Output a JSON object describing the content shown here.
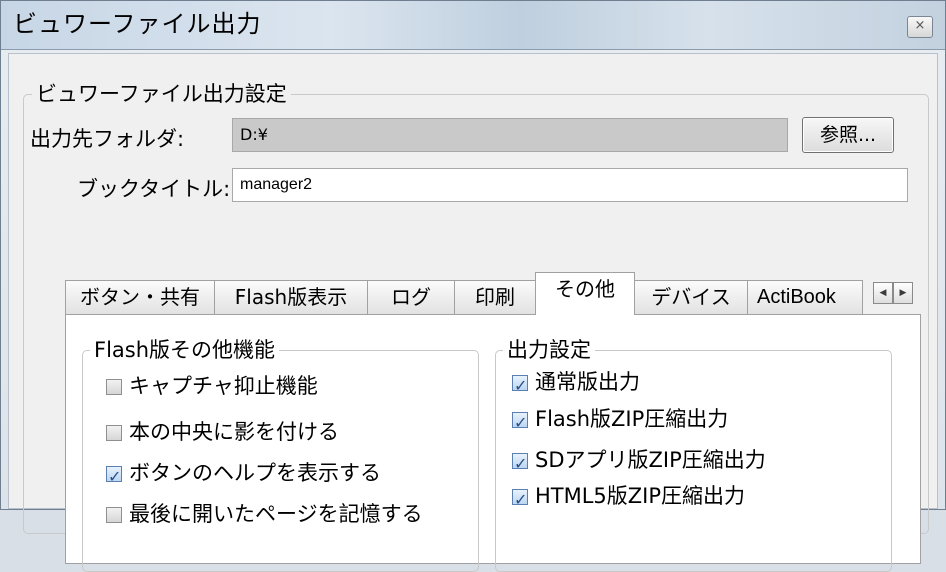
{
  "window": {
    "title": "ビュワーファイル出力",
    "close_icon": "close-icon"
  },
  "settings": {
    "group_title": "ビュワーファイル出力設定",
    "output_folder_label": "出力先フォルダ:",
    "output_folder_value": "D:¥",
    "browse_label": "参照...",
    "book_title_label": "ブックタイトル:",
    "book_title_value": "manager2"
  },
  "tabs": [
    {
      "label": "ボタン・共有"
    },
    {
      "label": "Flash版表示"
    },
    {
      "label": "ログ"
    },
    {
      "label": "印刷"
    },
    {
      "label": "その他",
      "selected": true
    },
    {
      "label": "デバイス"
    },
    {
      "label": "ActiBook"
    }
  ],
  "tab_scroll": {
    "left_icon": "left-arrow-icon",
    "right_icon": "right-arrow-icon"
  },
  "flash_features": {
    "title": "Flash版その他機能",
    "items": [
      {
        "label": "キャプチャ抑止機能",
        "checked": false
      },
      {
        "label": "本の中央に影を付ける",
        "checked": false
      },
      {
        "label": "ボタンのヘルプを表示する",
        "checked": true
      },
      {
        "label": "最後に開いたページを記憶する",
        "checked": false
      }
    ]
  },
  "output_settings": {
    "title": "出力設定",
    "items": [
      {
        "label": "通常版出力",
        "checked": true
      },
      {
        "label": "Flash版ZIP圧縮出力",
        "checked": true
      },
      {
        "label": "SDアプリ版ZIP圧縮出力",
        "checked": true
      },
      {
        "label": "HTML5版ZIP圧縮出力",
        "checked": true
      }
    ]
  },
  "colors": {
    "check_accent": "#2a4f86",
    "window_border": "#6f7f90"
  }
}
